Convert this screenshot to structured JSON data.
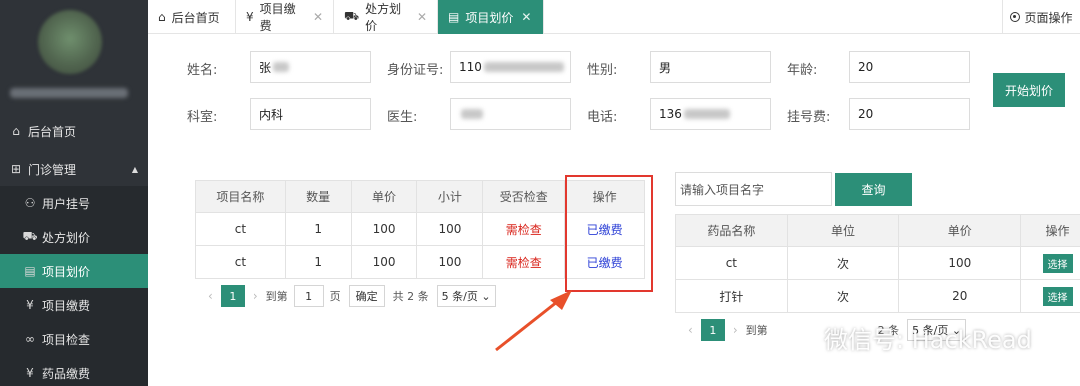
{
  "sidebar": {
    "items": [
      {
        "label": "后台首页",
        "icon": "home-icon"
      },
      {
        "label": "门诊管理",
        "icon": "grid-icon"
      },
      {
        "label": "用户挂号",
        "icon": "user-icon"
      },
      {
        "label": "处方划价",
        "icon": "cart-icon"
      },
      {
        "label": "项目划价",
        "icon": "document-icon"
      },
      {
        "label": "项目缴费",
        "icon": "yen-icon"
      },
      {
        "label": "项目检查",
        "icon": "infinity-icon"
      },
      {
        "label": "药品缴费",
        "icon": "yen-icon"
      }
    ]
  },
  "tabs": [
    {
      "label": "后台首页",
      "icon": "home-icon"
    },
    {
      "label": "项目缴费",
      "icon": "yen-icon"
    },
    {
      "label": "处方划价",
      "icon": "cart-icon"
    },
    {
      "label": "项目划价",
      "icon": "document-icon"
    }
  ],
  "page_op": "页面操作",
  "form": {
    "name_label": "姓名:",
    "name_value": "张",
    "id_label": "身份证号:",
    "id_value": "110",
    "gender_label": "性别:",
    "gender_value": "男",
    "age_label": "年龄:",
    "age_value": "20",
    "dept_label": "科室:",
    "dept_value": "内科",
    "doctor_label": "医生:",
    "phone_label": "电话:",
    "phone_value": "136",
    "fee_label": "挂号费:",
    "fee_value": "20",
    "start_button": "开始划价"
  },
  "project_table": {
    "headers": [
      "项目名称",
      "数量",
      "单价",
      "小计",
      "受否检查",
      "操作"
    ],
    "rows": [
      [
        "ct",
        "1",
        "100",
        "100",
        "需检查",
        "已缴费"
      ],
      [
        "ct",
        "1",
        "100",
        "100",
        "需检查",
        "已缴费"
      ]
    ],
    "pager": {
      "page": "1",
      "goto": "到第",
      "goto_value": "1",
      "page_unit": "页",
      "confirm": "确定",
      "total": "共 2 条",
      "size": "5 条/页"
    }
  },
  "search": {
    "placeholder": "请输入项目名字",
    "button": "查询"
  },
  "drug_table": {
    "headers": [
      "药品名称",
      "单位",
      "单价",
      "操作"
    ],
    "rows": [
      [
        "ct",
        "次",
        "100",
        "选择"
      ],
      [
        "打针",
        "次",
        "20",
        "选择"
      ]
    ],
    "pager": {
      "page": "1",
      "goto": "到第",
      "total_part": "2 条",
      "size": "5 条/页"
    }
  },
  "watermark": "微信号: HackRead",
  "colors": {
    "accent": "#2c8f78",
    "sidebar": "#2f3338",
    "need_check": "#d9251c",
    "paid": "#2b3fd6",
    "highlight_box": "#e2382e"
  }
}
